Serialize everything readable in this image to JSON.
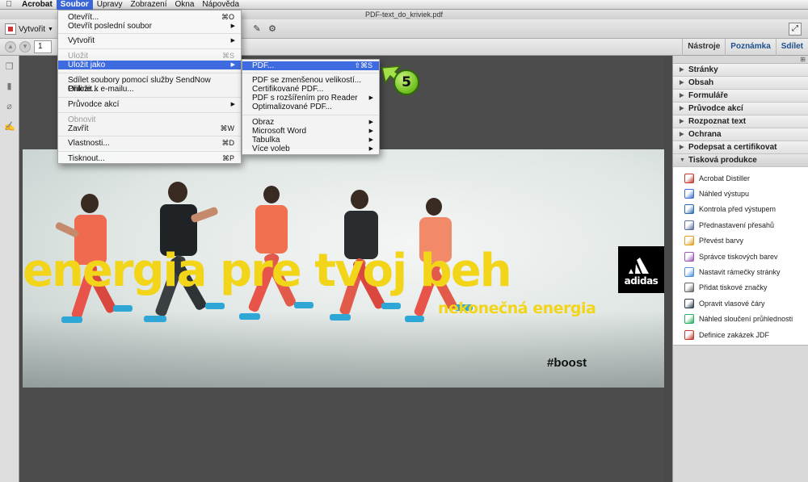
{
  "menubar": {
    "items": [
      "Acrobat",
      "Soubor",
      "Úpravy",
      "Zobrazení",
      "Okna",
      "Nápověda"
    ],
    "open_item": "Soubor"
  },
  "window": {
    "title": "PDF-text_do_kriviek.pdf"
  },
  "toolbar": {
    "create_label": "Vytvořit"
  },
  "nav": {
    "page_value": "1",
    "right_tabs": [
      "Nástroje",
      "Poznámka",
      "Sdílet"
    ],
    "active_tab": "Poznámka"
  },
  "file_menu": {
    "items": [
      {
        "label": "Otevřít...",
        "shortcut": "⌘O"
      },
      {
        "label": "Otevřít poslední soubor",
        "submenu": true
      },
      {
        "label": "Vytvořit",
        "submenu": true
      },
      {
        "label": "Uložit",
        "shortcut": "⌘S",
        "disabled": true
      },
      {
        "label": "Uložit jako",
        "submenu": true,
        "highlighted": true
      },
      {
        "label": "Sdílet soubory pomocí služby SendNow Online..."
      },
      {
        "label": "Přiložit k e-mailu..."
      },
      {
        "label": "Průvodce akcí",
        "submenu": true
      },
      {
        "label": "Obnovit",
        "disabled": true
      },
      {
        "label": "Zavřít",
        "shortcut": "⌘W"
      },
      {
        "label": "Vlastnosti...",
        "shortcut": "⌘D"
      },
      {
        "label": "Tisknout...",
        "shortcut": "⌘P"
      }
    ]
  },
  "save_as_menu": {
    "items": [
      {
        "label": "PDF...",
        "shortcut": "⇧⌘S",
        "highlighted": true
      },
      {
        "label": "PDF se zmenšenou velikostí..."
      },
      {
        "label": "Certifikované PDF..."
      },
      {
        "label": "PDF s rozšířením pro Reader",
        "submenu": true
      },
      {
        "label": "Optimalizované PDF..."
      },
      {
        "label": "Obraz",
        "submenu": true
      },
      {
        "label": "Microsoft Word",
        "submenu": true
      },
      {
        "label": "Tabulka",
        "submenu": true
      },
      {
        "label": "Více voleb",
        "submenu": true
      }
    ]
  },
  "callout": {
    "step": "5"
  },
  "banner": {
    "slogan": "energia pre tvoj beh",
    "subslogan": "nekonečná energia",
    "hashtag": "#boost",
    "brand": "adidas",
    "accent_color": "#f2d419"
  },
  "panel": {
    "sections": [
      "Stránky",
      "Obsah",
      "Formuláře",
      "Průvodce akcí",
      "Rozpoznat text",
      "Ochrana",
      "Podepsat a certifikovat"
    ],
    "open_section": "Tisková produkce",
    "tools": [
      {
        "label": "Acrobat Distiller",
        "color": "#c0392b"
      },
      {
        "label": "Náhled výstupu",
        "color": "#3b6fd1"
      },
      {
        "label": "Kontrola před výstupem",
        "color": "#2b6cb0"
      },
      {
        "label": "Přednastavení přesahů",
        "color": "#5a6ea0"
      },
      {
        "label": "Převést barvy",
        "color": "#e0a020"
      },
      {
        "label": "Správce tiskových barev",
        "color": "#9b59b6"
      },
      {
        "label": "Nastavit rámečky stránky",
        "color": "#4a90d9"
      },
      {
        "label": "Přidat tiskové značky",
        "color": "#666666"
      },
      {
        "label": "Opravit vlasové čáry",
        "color": "#2c3e50"
      },
      {
        "label": "Náhled sloučení průhlednosti",
        "color": "#27ae60"
      },
      {
        "label": "Definice zakázek JDF",
        "color": "#c0392b"
      }
    ]
  }
}
